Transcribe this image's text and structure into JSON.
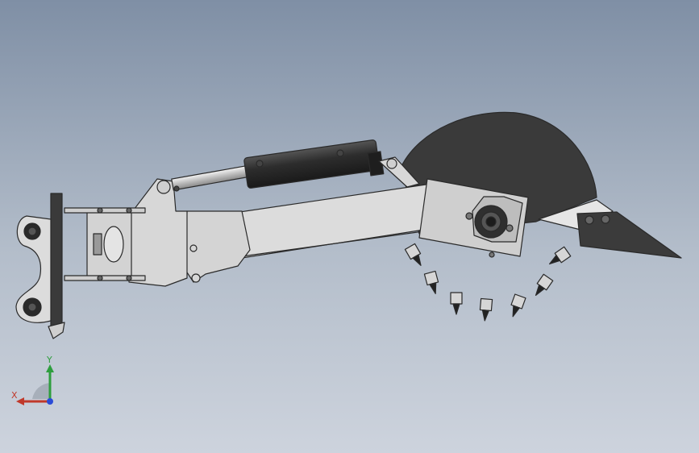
{
  "viewport": {
    "background_top": "#7f8fa5",
    "background_bottom": "#cdd3dd"
  },
  "model": {
    "part_color": "#d9d9d9",
    "edge_color": "#2a2a2a",
    "dark_color": "#333333",
    "cylinder_color": "#2b2b2b"
  },
  "triad": {
    "x_label": "X",
    "y_label": "Y",
    "x_color": "#c0392b",
    "y_color": "#2e9e3e",
    "z_color": "#2a4bd7"
  }
}
